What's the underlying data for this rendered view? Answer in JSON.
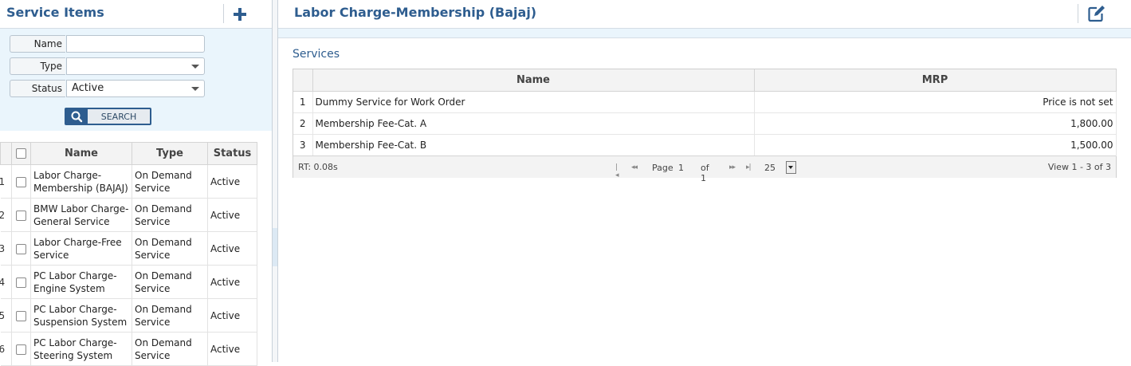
{
  "left": {
    "title": "Service Items",
    "filters": {
      "name_label": "Name",
      "name_value": "",
      "type_label": "Type",
      "type_value": "",
      "status_label": "Status",
      "status_value": "Active",
      "search_label": "SEARCH"
    },
    "columns": [
      "Name",
      "Type",
      "Status"
    ],
    "rows": [
      {
        "num": "1",
        "name": "Labor Charge-Membership (BAJAJ)",
        "type": "On Demand Service",
        "status": "Active"
      },
      {
        "num": "2",
        "name": "BMW Labor Charge-General Service",
        "type": "On Demand Service",
        "status": "Active"
      },
      {
        "num": "3",
        "name": "Labor Charge-Free Service",
        "type": "On Demand Service",
        "status": "Active"
      },
      {
        "num": "4",
        "name": "PC Labor Charge-Engine System",
        "type": "On Demand Service",
        "status": "Active"
      },
      {
        "num": "5",
        "name": "PC Labor Charge-Suspension System",
        "type": "On Demand Service",
        "status": "Active"
      },
      {
        "num": "6",
        "name": "PC Labor Charge-Steering System",
        "type": "On Demand Service",
        "status": "Active"
      }
    ]
  },
  "right": {
    "title": "Labor Charge-Membership (Bajaj)",
    "section_title": "Services",
    "columns": [
      "Name",
      "MRP"
    ],
    "rows": [
      {
        "num": "1",
        "name": "Dummy Service for Work Order",
        "mrp": "Price is not set"
      },
      {
        "num": "2",
        "name": "Membership Fee-Cat. A",
        "mrp": "1,800.00"
      },
      {
        "num": "3",
        "name": "Membership Fee-Cat. B",
        "mrp": "1,500.00"
      }
    ],
    "pager": {
      "rt": "RT: 0.08s",
      "page_label": "Page",
      "page_value": "1",
      "of_label": "of 1",
      "rows_per_page": "25",
      "view": "View 1 - 3 of 3"
    }
  },
  "colors": {
    "accent": "#2e5d8f",
    "filter_bg": "#eaf5fc"
  },
  "icons": [
    "plus-icon",
    "edit-icon",
    "search-icon",
    "first-page-icon",
    "prev-page-icon",
    "next-page-icon",
    "last-page-icon",
    "dropdown-caret-icon"
  ]
}
